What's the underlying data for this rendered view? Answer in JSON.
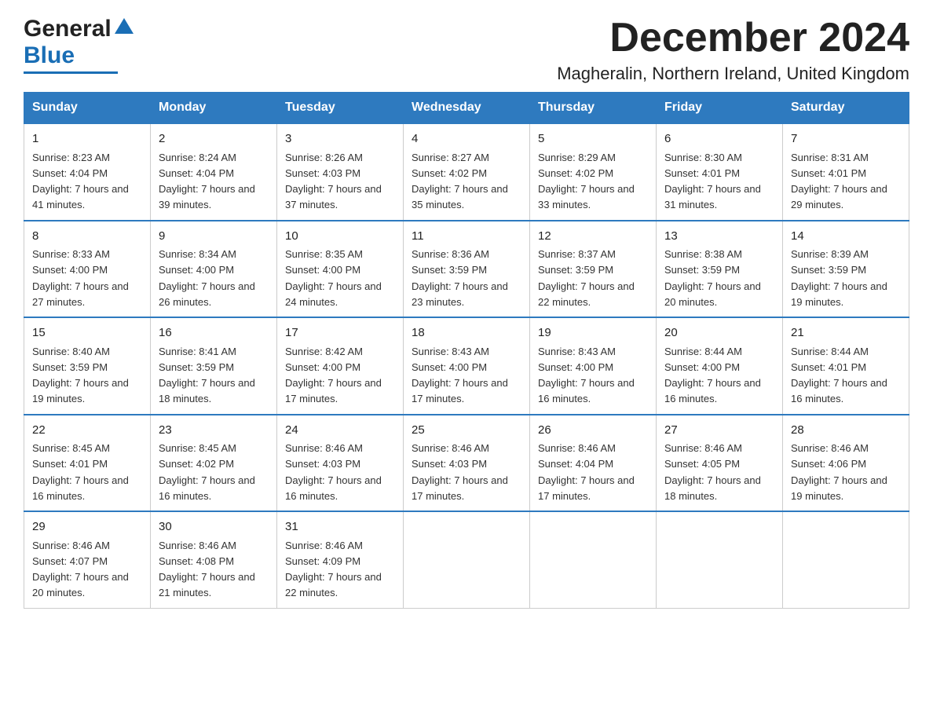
{
  "header": {
    "title": "December 2024",
    "subtitle": "Magheralin, Northern Ireland, United Kingdom",
    "logo_general": "General",
    "logo_blue": "Blue"
  },
  "days_of_week": [
    "Sunday",
    "Monday",
    "Tuesday",
    "Wednesday",
    "Thursday",
    "Friday",
    "Saturday"
  ],
  "weeks": [
    [
      {
        "day": "1",
        "sunrise": "8:23 AM",
        "sunset": "4:04 PM",
        "daylight": "7 hours and 41 minutes."
      },
      {
        "day": "2",
        "sunrise": "8:24 AM",
        "sunset": "4:04 PM",
        "daylight": "7 hours and 39 minutes."
      },
      {
        "day": "3",
        "sunrise": "8:26 AM",
        "sunset": "4:03 PM",
        "daylight": "7 hours and 37 minutes."
      },
      {
        "day": "4",
        "sunrise": "8:27 AM",
        "sunset": "4:02 PM",
        "daylight": "7 hours and 35 minutes."
      },
      {
        "day": "5",
        "sunrise": "8:29 AM",
        "sunset": "4:02 PM",
        "daylight": "7 hours and 33 minutes."
      },
      {
        "day": "6",
        "sunrise": "8:30 AM",
        "sunset": "4:01 PM",
        "daylight": "7 hours and 31 minutes."
      },
      {
        "day": "7",
        "sunrise": "8:31 AM",
        "sunset": "4:01 PM",
        "daylight": "7 hours and 29 minutes."
      }
    ],
    [
      {
        "day": "8",
        "sunrise": "8:33 AM",
        "sunset": "4:00 PM",
        "daylight": "7 hours and 27 minutes."
      },
      {
        "day": "9",
        "sunrise": "8:34 AM",
        "sunset": "4:00 PM",
        "daylight": "7 hours and 26 minutes."
      },
      {
        "day": "10",
        "sunrise": "8:35 AM",
        "sunset": "4:00 PM",
        "daylight": "7 hours and 24 minutes."
      },
      {
        "day": "11",
        "sunrise": "8:36 AM",
        "sunset": "3:59 PM",
        "daylight": "7 hours and 23 minutes."
      },
      {
        "day": "12",
        "sunrise": "8:37 AM",
        "sunset": "3:59 PM",
        "daylight": "7 hours and 22 minutes."
      },
      {
        "day": "13",
        "sunrise": "8:38 AM",
        "sunset": "3:59 PM",
        "daylight": "7 hours and 20 minutes."
      },
      {
        "day": "14",
        "sunrise": "8:39 AM",
        "sunset": "3:59 PM",
        "daylight": "7 hours and 19 minutes."
      }
    ],
    [
      {
        "day": "15",
        "sunrise": "8:40 AM",
        "sunset": "3:59 PM",
        "daylight": "7 hours and 19 minutes."
      },
      {
        "day": "16",
        "sunrise": "8:41 AM",
        "sunset": "3:59 PM",
        "daylight": "7 hours and 18 minutes."
      },
      {
        "day": "17",
        "sunrise": "8:42 AM",
        "sunset": "4:00 PM",
        "daylight": "7 hours and 17 minutes."
      },
      {
        "day": "18",
        "sunrise": "8:43 AM",
        "sunset": "4:00 PM",
        "daylight": "7 hours and 17 minutes."
      },
      {
        "day": "19",
        "sunrise": "8:43 AM",
        "sunset": "4:00 PM",
        "daylight": "7 hours and 16 minutes."
      },
      {
        "day": "20",
        "sunrise": "8:44 AM",
        "sunset": "4:00 PM",
        "daylight": "7 hours and 16 minutes."
      },
      {
        "day": "21",
        "sunrise": "8:44 AM",
        "sunset": "4:01 PM",
        "daylight": "7 hours and 16 minutes."
      }
    ],
    [
      {
        "day": "22",
        "sunrise": "8:45 AM",
        "sunset": "4:01 PM",
        "daylight": "7 hours and 16 minutes."
      },
      {
        "day": "23",
        "sunrise": "8:45 AM",
        "sunset": "4:02 PM",
        "daylight": "7 hours and 16 minutes."
      },
      {
        "day": "24",
        "sunrise": "8:46 AM",
        "sunset": "4:03 PM",
        "daylight": "7 hours and 16 minutes."
      },
      {
        "day": "25",
        "sunrise": "8:46 AM",
        "sunset": "4:03 PM",
        "daylight": "7 hours and 17 minutes."
      },
      {
        "day": "26",
        "sunrise": "8:46 AM",
        "sunset": "4:04 PM",
        "daylight": "7 hours and 17 minutes."
      },
      {
        "day": "27",
        "sunrise": "8:46 AM",
        "sunset": "4:05 PM",
        "daylight": "7 hours and 18 minutes."
      },
      {
        "day": "28",
        "sunrise": "8:46 AM",
        "sunset": "4:06 PM",
        "daylight": "7 hours and 19 minutes."
      }
    ],
    [
      {
        "day": "29",
        "sunrise": "8:46 AM",
        "sunset": "4:07 PM",
        "daylight": "7 hours and 20 minutes."
      },
      {
        "day": "30",
        "sunrise": "8:46 AM",
        "sunset": "4:08 PM",
        "daylight": "7 hours and 21 minutes."
      },
      {
        "day": "31",
        "sunrise": "8:46 AM",
        "sunset": "4:09 PM",
        "daylight": "7 hours and 22 minutes."
      },
      null,
      null,
      null,
      null
    ]
  ],
  "labels": {
    "sunrise": "Sunrise:",
    "sunset": "Sunset:",
    "daylight": "Daylight:"
  }
}
